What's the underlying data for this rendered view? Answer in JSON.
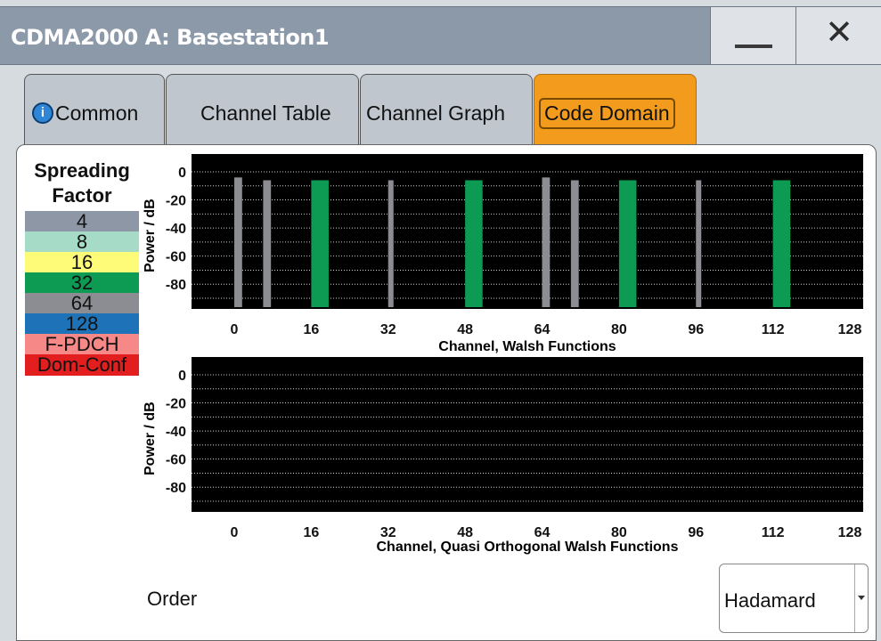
{
  "window": {
    "title": "CDMA2000 A: Basestation1",
    "minimize_icon": "minimize-icon",
    "close_icon": "close-icon",
    "close_glyph": "✕"
  },
  "tabs": [
    {
      "label": "Common",
      "icon": "info-icon",
      "active": false
    },
    {
      "label": "Channel Table",
      "active": false
    },
    {
      "label": "Channel Graph",
      "active": false
    },
    {
      "label": "Code Domain",
      "active": true
    }
  ],
  "colors": {
    "active_tab": "#f29b1d",
    "sf4": "#8e97a6",
    "sf8": "#a6dcc7",
    "sf16": "#fdfb78",
    "sf32": "#0d9a53",
    "sf64": "#8b8d92",
    "sf128": "#1e73b8",
    "fpdch": "#f68888",
    "domconf": "#e31e1e"
  },
  "legend": {
    "title_line1": "Spreading",
    "title_line2": "Factor",
    "items": [
      {
        "label": "4",
        "color": "#8e97a6",
        "text_color": "#111"
      },
      {
        "label": "8",
        "color": "#a6dcc7",
        "text_color": "#111"
      },
      {
        "label": "16",
        "color": "#fdfb78",
        "text_color": "#111"
      },
      {
        "label": "32",
        "color": "#0d9a53",
        "text_color": "#111"
      },
      {
        "label": "64",
        "color": "#8b8d92",
        "text_color": "#111"
      },
      {
        "label": "128",
        "color": "#1e73b8",
        "text_color": "#111"
      },
      {
        "label": "F-PDCH",
        "color": "#f68888",
        "text_color": "#111"
      },
      {
        "label": "Dom-Conf",
        "color": "#e31e1e",
        "text_color": "#111"
      }
    ]
  },
  "chart_data": [
    {
      "type": "bar",
      "ylabel": "Power / dB",
      "xlabel": "Channel, Walsh Functions",
      "xlim": [
        0,
        128
      ],
      "ylim": [
        -90,
        0
      ],
      "yticks": [
        "0",
        "-20",
        "-40",
        "-60",
        "-80"
      ],
      "xticks": [
        "0",
        "16",
        "32",
        "48",
        "64",
        "80",
        "96",
        "112",
        "128"
      ],
      "grid": true,
      "bars": [
        {
          "start": 0,
          "width": 2,
          "value": -4,
          "sf": "64"
        },
        {
          "start": 6,
          "width": 2,
          "value": -6,
          "sf": "64"
        },
        {
          "start": 16,
          "width": 4,
          "value": -6,
          "sf": "32"
        },
        {
          "start": 32,
          "width": 1,
          "value": -6,
          "sf": "64"
        },
        {
          "start": 48,
          "width": 4,
          "value": -6,
          "sf": "32"
        },
        {
          "start": 64,
          "width": 2,
          "value": -4,
          "sf": "64"
        },
        {
          "start": 70,
          "width": 2,
          "value": -6,
          "sf": "64"
        },
        {
          "start": 80,
          "width": 4,
          "value": -6,
          "sf": "32"
        },
        {
          "start": 96,
          "width": 1,
          "value": -6,
          "sf": "64"
        },
        {
          "start": 112,
          "width": 4,
          "value": -6,
          "sf": "32"
        }
      ]
    },
    {
      "type": "bar",
      "ylabel": "Power / dB",
      "xlabel": "Channel, Quasi Orthogonal Walsh Functions",
      "xlim": [
        0,
        128
      ],
      "ylim": [
        -90,
        0
      ],
      "yticks": [
        "0",
        "-20",
        "-40",
        "-60",
        "-80"
      ],
      "xticks": [
        "0",
        "16",
        "32",
        "48",
        "64",
        "80",
        "96",
        "112",
        "128"
      ],
      "grid": true,
      "bars": []
    }
  ],
  "order": {
    "label": "Order",
    "value": "Hadamard"
  }
}
